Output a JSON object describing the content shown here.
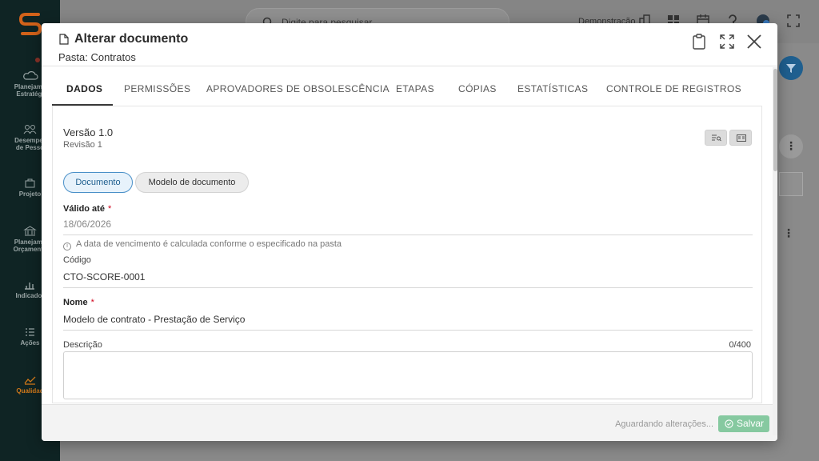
{
  "app": {
    "sidebar": {
      "items": [
        {
          "label": "Planejamento Estratégico",
          "line1": "Planejame",
          "line2": "Estratégi"
        },
        {
          "label": "Desempenho de Pessoas",
          "line1": "Desemper",
          "line2": "de Pesso"
        },
        {
          "label": "Projetos",
          "line1": "Projeto",
          "line2": ""
        },
        {
          "label": "Planejamento Orçamentário",
          "line1": "Planejame",
          "line2": "Orçamenta"
        },
        {
          "label": "Indicadores",
          "line1": "Indicador",
          "line2": ""
        },
        {
          "label": "Ações",
          "line1": "Ações",
          "line2": ""
        },
        {
          "label": "Qualidade",
          "line1": "Qualidad",
          "line2": ""
        }
      ]
    },
    "topbar": {
      "search_placeholder": "Digite para pesquisar...",
      "environment_label": "Demonstração"
    },
    "colors": {
      "sidebar_bg": "#0f2424",
      "accent": "#d2791a",
      "primary": "#1f5f8f",
      "save_green": "#86c9a0"
    }
  },
  "modal": {
    "title": "Alterar documento",
    "subtitle": "Pasta: Contratos",
    "header_icons": [
      "clipboard-icon",
      "expand-icon",
      "close-icon"
    ],
    "tabs": [
      {
        "label": "DADOS",
        "active": true
      },
      {
        "label": "PERMISSÕES",
        "active": false
      },
      {
        "label": "APROVADORES DE OBSOLESCÊNCIA",
        "active": false
      },
      {
        "label": "ETAPAS",
        "active": false
      },
      {
        "label": "CÓPIAS",
        "active": false
      },
      {
        "label": "ESTATÍSTICAS",
        "active": false
      },
      {
        "label": "CONTROLE DE REGISTROS",
        "active": false
      }
    ],
    "version": "Versão 1.0",
    "revision": "Revisão 1",
    "chips": {
      "document": "Documento",
      "template": "Modelo de documento"
    },
    "fields": {
      "valid_until": {
        "label": "Válido até",
        "required_mark": "*",
        "value": "18/06/2026",
        "hint": "A data de vencimento é calculada conforme o especificado na pasta"
      },
      "code": {
        "label": "Código",
        "value": "CTO-SCORE-0001"
      },
      "name": {
        "label": "Nome",
        "required_mark": "*",
        "value": "Modelo de contrato - Prestação de Serviço"
      },
      "description": {
        "label": "Descrição",
        "counter": "0/400",
        "value": ""
      }
    },
    "footer": {
      "status": "Aguardando alterações...",
      "save_label": "Salvar"
    }
  }
}
